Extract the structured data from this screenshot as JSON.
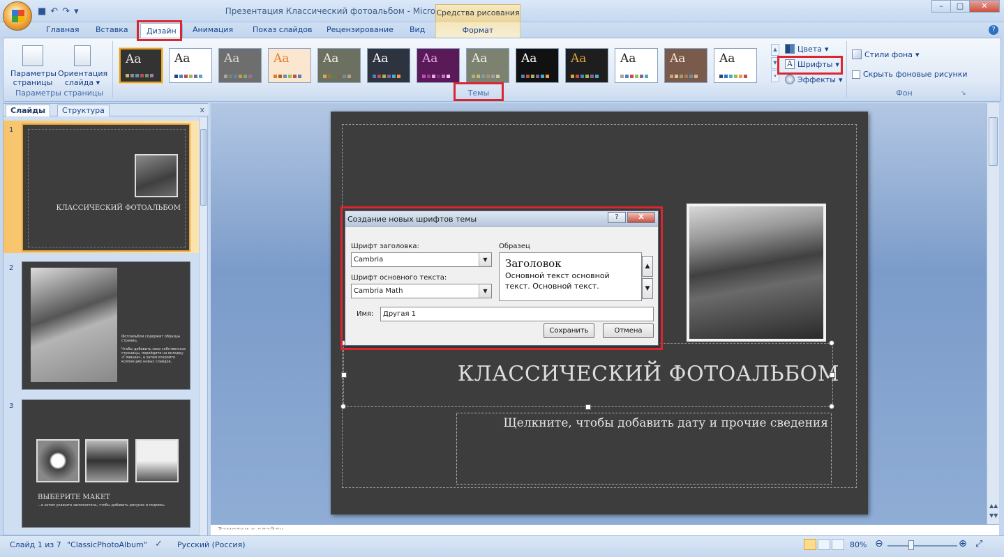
{
  "window": {
    "title": "Презентация Классический фотоальбом - Microsoft PowerPoint",
    "context_group": "Средства рисования",
    "controls": {
      "minimize": "–",
      "maximize": "□",
      "close": "✕"
    }
  },
  "tabs": [
    "Главная",
    "Вставка",
    "Дизайн",
    "Анимация",
    "Показ слайдов",
    "Рецензирование",
    "Вид"
  ],
  "active_tab": "Дизайн",
  "context_tab": "Формат",
  "ribbon": {
    "page_setup": {
      "params_label": "Параметры страницы",
      "orientation_label": "Ориентация слайда",
      "group_label": "Параметры страницы"
    },
    "themes": {
      "group_label": "Темы",
      "thumb_text": "Aa",
      "items": [
        {
          "name": "theme-1",
          "bg": "#333333",
          "fg": "#ececec",
          "sw": [
            "#c7b86a",
            "#8c8c8c",
            "#6a8fb2",
            "#b05050",
            "#6d9e5a",
            "#9c7db5"
          ]
        },
        {
          "name": "theme-2",
          "bg": "#ffffff",
          "fg": "#222222",
          "sw": [
            "#1f497d",
            "#4f81bd",
            "#c0504d",
            "#9bbb59",
            "#8064a2",
            "#4bacc6"
          ]
        },
        {
          "name": "theme-3",
          "bg": "#6e6e6e",
          "fg": "#d8d8d8",
          "sw": [
            "#a5a5a5",
            "#7f7f7f",
            "#5d8aa8",
            "#bfa04c",
            "#8aa86a",
            "#9d6d9d"
          ]
        },
        {
          "name": "theme-4",
          "bg": "#fbe7d0",
          "fg": "#e07b29",
          "sw": [
            "#e07b29",
            "#b85b1a",
            "#6a8fb2",
            "#9bbb59",
            "#c0504d",
            "#4f81bd"
          ]
        },
        {
          "name": "theme-5",
          "bg": "#6c7060",
          "fg": "#f1f1e0",
          "sw": [
            "#c9b24d",
            "#a26e3f",
            "#5b7f4d",
            "#8f5c4f",
            "#6b8fa5",
            "#b8a37e"
          ]
        },
        {
          "name": "theme-6",
          "bg": "#2d3440",
          "fg": "#ffffff",
          "sw": [
            "#4f81bd",
            "#c0504d",
            "#9bbb59",
            "#8064a2",
            "#4bacc6",
            "#f79646"
          ]
        },
        {
          "name": "theme-7",
          "bg": "#5a1a58",
          "fg": "#e8a6e6",
          "sw": [
            "#c34bc0",
            "#9e3c9b",
            "#e7a8e5",
            "#7b2f79",
            "#d46bd2",
            "#f1c2ef"
          ]
        },
        {
          "name": "theme-8",
          "bg": "#7d8270",
          "fg": "#f2f2e6",
          "sw": [
            "#a9b47a",
            "#c6b576",
            "#7d9bb3",
            "#b78c6a",
            "#9aa0a8",
            "#d1c7a0"
          ]
        },
        {
          "name": "theme-9",
          "bg": "#111111",
          "fg": "#ffffff",
          "sw": [
            "#4f81bd",
            "#c0504d",
            "#9bbb59",
            "#8064a2",
            "#4bacc6",
            "#f79646"
          ]
        },
        {
          "name": "theme-10",
          "bg": "#1e1e1e",
          "fg": "#e0a23c",
          "sw": [
            "#e0a23c",
            "#c0504d",
            "#4f81bd",
            "#9bbb59",
            "#8064a2",
            "#4bacc6"
          ]
        },
        {
          "name": "theme-11",
          "bg": "#ffffff",
          "fg": "#222222",
          "sw": [
            "#a5a5a5",
            "#4f81bd",
            "#c0504d",
            "#9bbb59",
            "#8064a2",
            "#4bacc6"
          ]
        },
        {
          "name": "theme-12",
          "bg": "#7a5a4a",
          "fg": "#f5e6da",
          "sw": [
            "#c9a27e",
            "#e2c3a4",
            "#8fa56b",
            "#b0795a",
            "#6e8fa5",
            "#d6b48a"
          ]
        },
        {
          "name": "theme-13",
          "bg": "#ffffff",
          "fg": "#222222",
          "sw": [
            "#1f4e79",
            "#2e75b6",
            "#4bacc6",
            "#9bbb59",
            "#f79646",
            "#c0504d"
          ]
        }
      ]
    },
    "theme_options": {
      "colors": "Цвета",
      "fonts": "Шрифты",
      "effects": "Эффекты"
    },
    "background": {
      "styles": "Стили фона",
      "hide_graphics": "Скрыть фоновые рисунки",
      "group_label": "Фон"
    }
  },
  "slides_pane": {
    "tab_slides": "Слайды",
    "tab_outline": "Структура",
    "close": "x",
    "slides": [
      {
        "num": "1",
        "title": "КЛАССИЧЕСКИЙ ФОТОАЛЬБОМ"
      },
      {
        "num": "2",
        "text": "Фотоальбом содержит образцы страниц.\n\nЧтобы добавить свои собственные страницы, перейдите на вкладку «Главная», а затем откройте коллекцию новых слайдов."
      },
      {
        "num": "3",
        "title": "ВЫБЕРИТЕ МАКЕТ",
        "text": "...а затем укажите заполнитель, чтобы добавить рисунок и подпись."
      }
    ]
  },
  "slide": {
    "title": "КЛАССИЧЕСКИЙ ФОТОАЛЬБОМ",
    "subtitle": "Щелкните, чтобы добавить дату и прочие сведения"
  },
  "dialog": {
    "title": "Создание новых шрифтов темы",
    "help": "?",
    "close": "X",
    "heading_font_label": "Шрифт заголовка:",
    "heading_font_value": "Cambria",
    "body_font_label": "Шрифт основного текста:",
    "body_font_value": "Cambria Math",
    "sample_label": "Образец",
    "sample_heading": "Заголовок",
    "sample_body": "Основной текст основной текст. Основной текст.",
    "name_label": "Имя:",
    "name_value": "Другая 1",
    "save": "Сохранить",
    "cancel": "Отмена"
  },
  "notes": {
    "placeholder": "Заметки к слайду"
  },
  "status": {
    "slide": "Слайд 1 из 7",
    "theme": "\"ClassicPhotoAlbum\"",
    "language": "Русский (Россия)",
    "zoom": "80%"
  }
}
